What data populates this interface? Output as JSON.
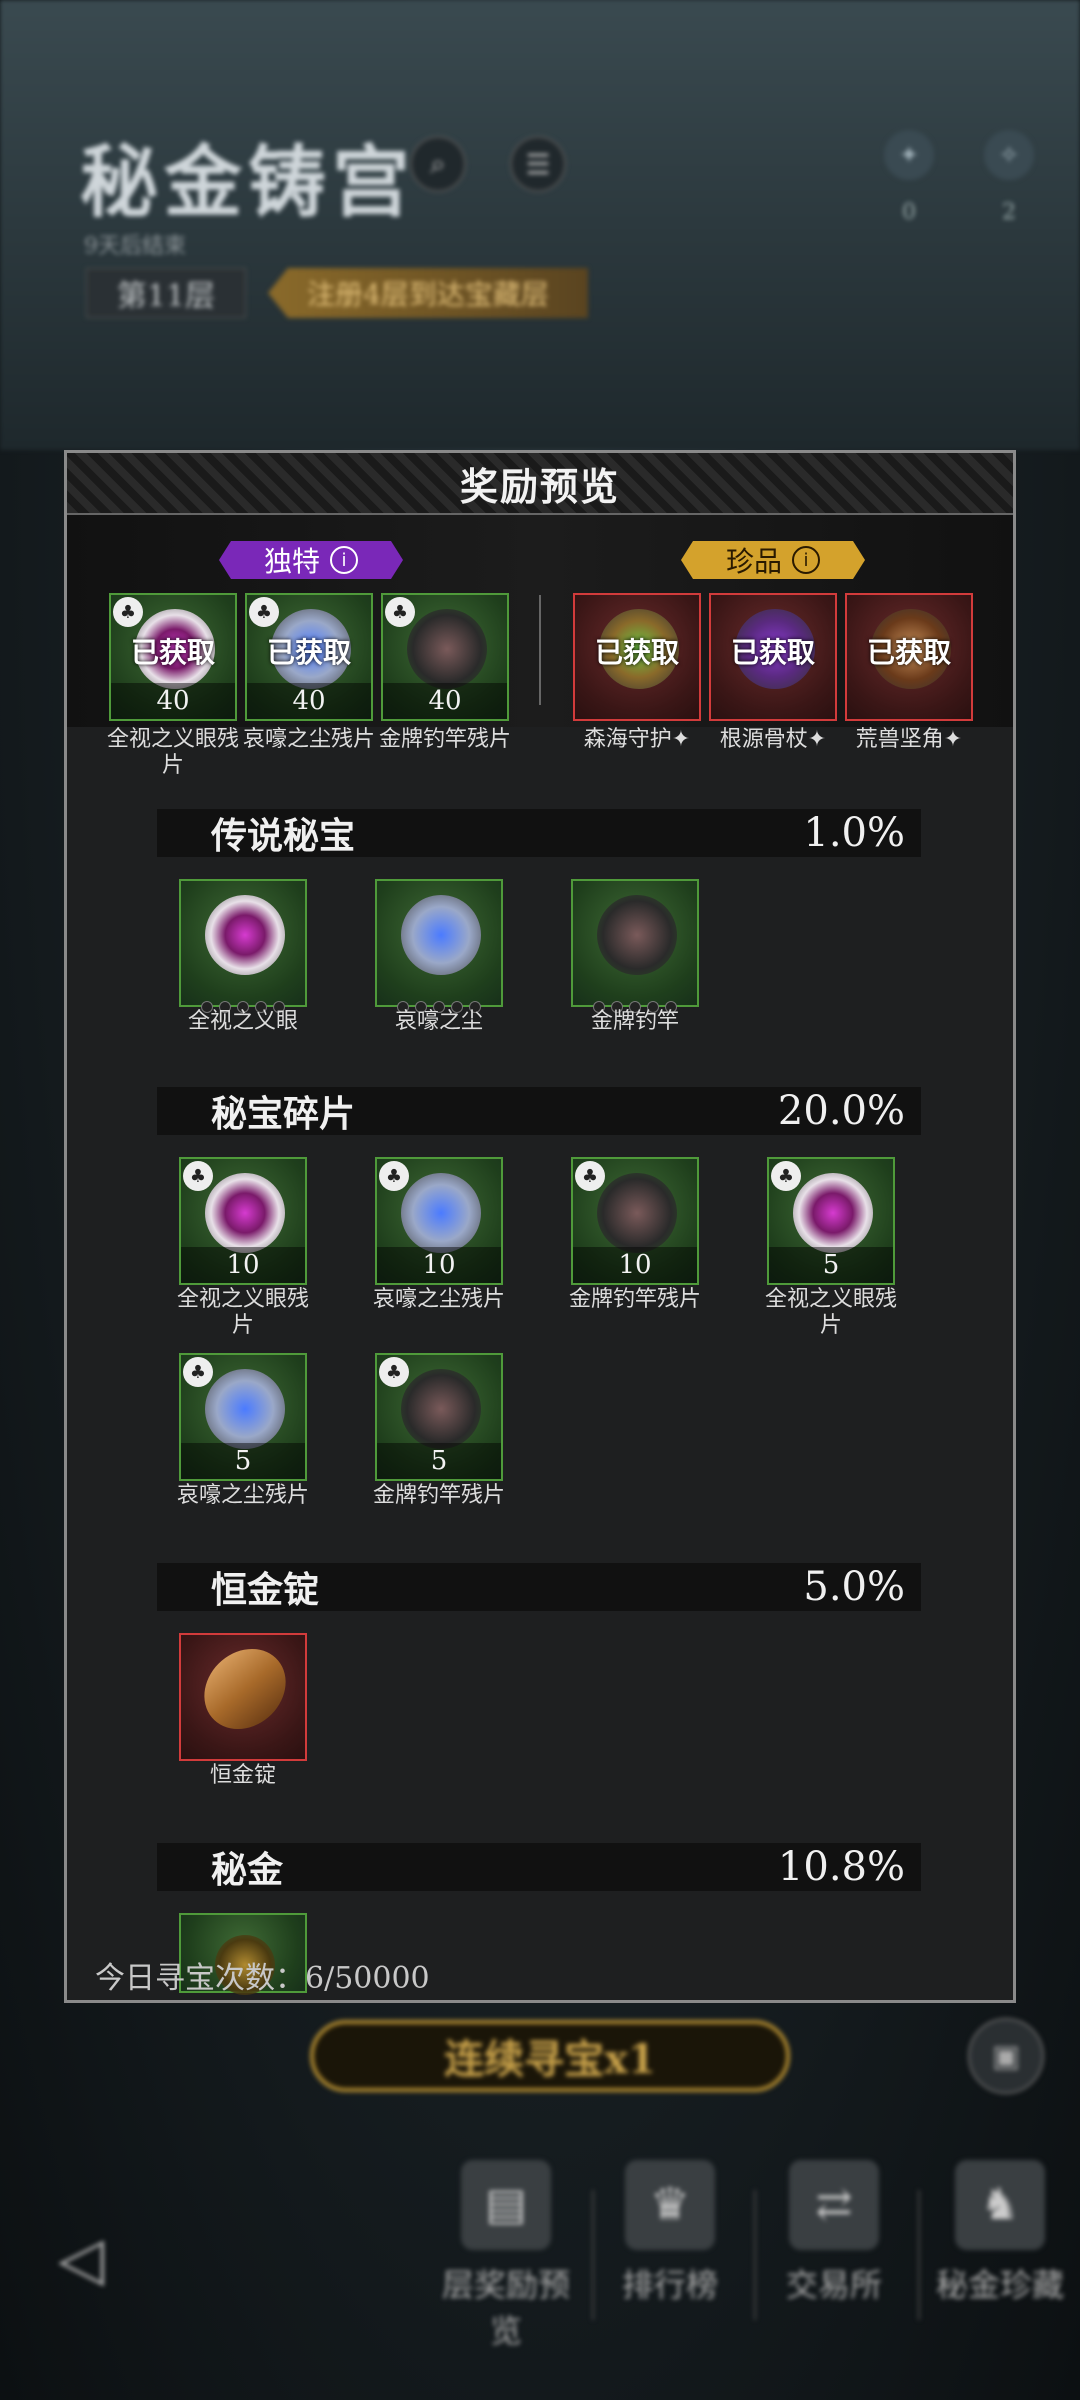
{
  "game": {
    "title": "秘金铸宫",
    "subtitle": "9天后结束",
    "floor": "第11层",
    "floor_banner": "注册4层到达宝藏层",
    "resources": [
      {
        "icon": "crystal-icon",
        "count": "0"
      },
      {
        "icon": "compass-icon",
        "count": "2"
      }
    ]
  },
  "modal": {
    "title": "奖励预览",
    "unique_tag": "独特",
    "rare_tag": "珍品",
    "unique_items": [
      {
        "name": "全视之义眼残片",
        "count": "40",
        "status": "已获取",
        "art": "eye"
      },
      {
        "name": "哀嚎之尘残片",
        "count": "40",
        "status": "已获取",
        "art": "teapot"
      },
      {
        "name": "金牌钓竿残片",
        "count": "40",
        "status": "",
        "art": "rod"
      }
    ],
    "rare_items": [
      {
        "name": "森海守护✦",
        "status": "已获取",
        "art": "staff"
      },
      {
        "name": "根源骨杖✦",
        "status": "已获取",
        "art": "bone"
      },
      {
        "name": "荒兽坚角✦",
        "status": "已获取",
        "art": "horn"
      }
    ],
    "sections": {
      "legend": {
        "name": "传说秘宝",
        "pct": "1.0%",
        "items": [
          {
            "name": "全视之义眼"
          },
          {
            "name": "哀嚎之尘"
          },
          {
            "name": "金牌钓竿"
          }
        ]
      },
      "fragments": {
        "name": "秘宝碎片",
        "pct": "20.0%",
        "items": [
          {
            "name": "全视之义眼残片",
            "count": "10"
          },
          {
            "name": "哀嚎之尘残片",
            "count": "10"
          },
          {
            "name": "金牌钓竿残片",
            "count": "10"
          },
          {
            "name": "全视之义眼残片",
            "count": "5"
          },
          {
            "name": "哀嚎之尘残片",
            "count": "5"
          },
          {
            "name": "金牌钓竿残片",
            "count": "5"
          }
        ]
      },
      "ingot": {
        "name": "恒金锭",
        "pct": "5.0%",
        "items": [
          {
            "name": "恒金锭"
          }
        ]
      },
      "gold": {
        "name": "秘金",
        "pct": "10.8%"
      }
    },
    "footer": "今日寻宝次数：6/50000"
  },
  "bottom": {
    "continue": "连续寻宝x1",
    "nav": [
      "层奖励预览",
      "排行榜",
      "交易所",
      "秘金珍藏"
    ]
  }
}
